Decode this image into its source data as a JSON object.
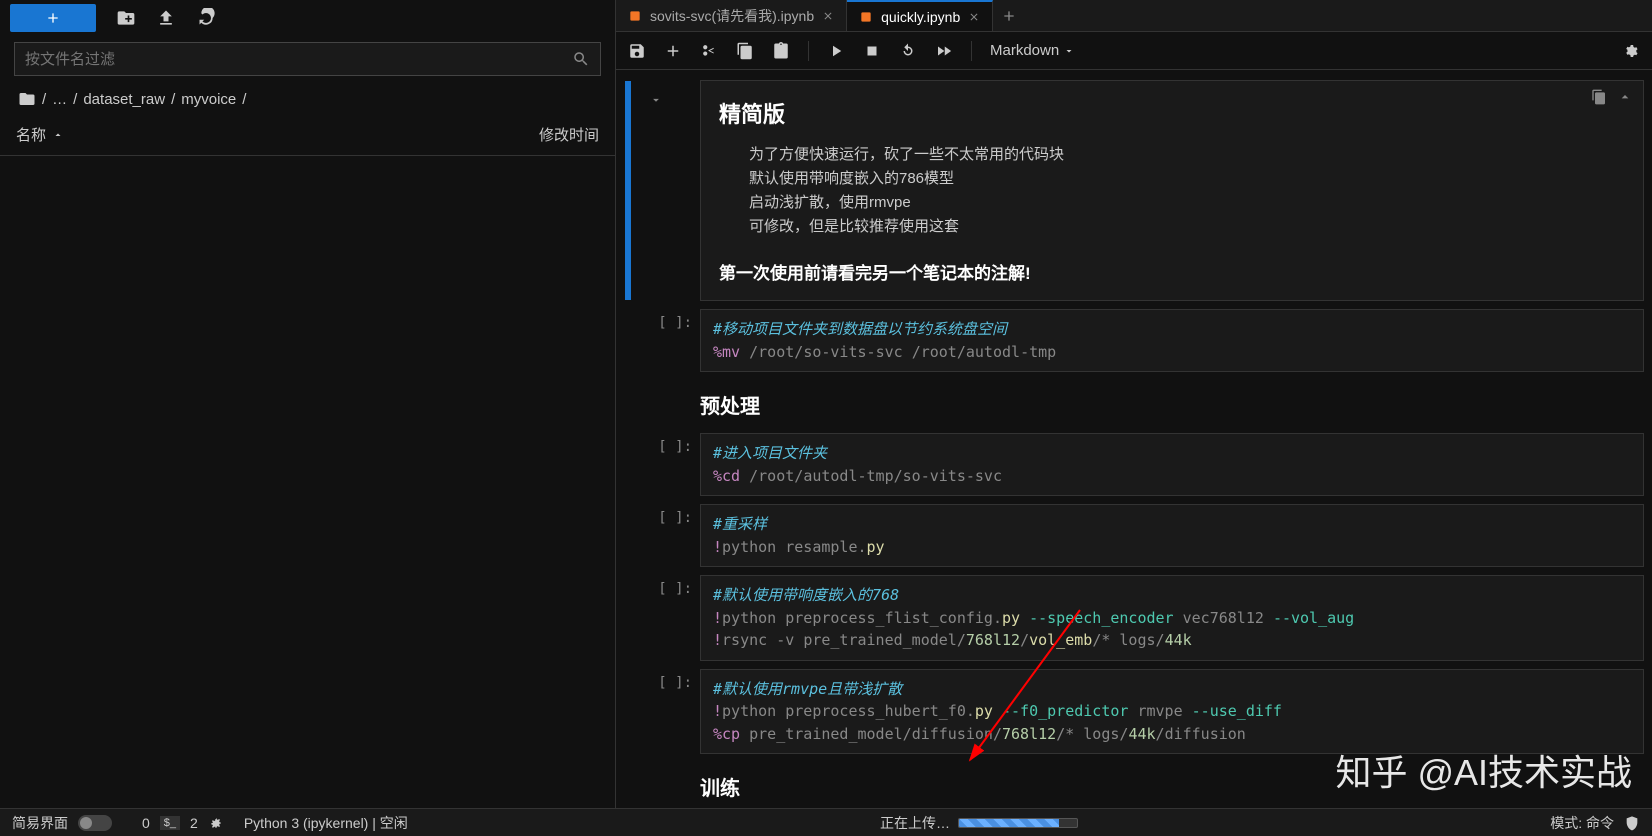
{
  "left_panel": {
    "filter_placeholder": "按文件名过滤",
    "breadcrumb": {
      "root_sep": "/",
      "dots": "…",
      "sep": "/",
      "p1": "dataset_raw",
      "p2": "myvoice"
    },
    "columns": {
      "name": "名称",
      "modified": "修改时间"
    }
  },
  "tabs": [
    {
      "label": "sovits-svc(请先看我).ipynb",
      "active": false
    },
    {
      "label": "quickly.ipynb",
      "active": true
    }
  ],
  "toolbar": {
    "celltype": "Markdown"
  },
  "notebook": {
    "md1": {
      "title": "精简版",
      "l1": "为了方便快速运行，砍了一些不太常用的代码块",
      "l2": "默认使用带响度嵌入的786模型",
      "l3": "启动浅扩散，使用rmvpe",
      "l4": "可修改，但是比较推荐使用这套",
      "bold": "第一次使用前请看完另一个笔记本的注解!"
    },
    "prompts": {
      "empty": "[ ]:"
    },
    "c1": {
      "comment": "#移动项目文件夹到数据盘以节约系统盘空间",
      "line": "%mv /root/so-vits-svc /root/autodl-tmp"
    },
    "h2_1": "预处理",
    "c2": {
      "comment": "#进入项目文件夹",
      "line": "%cd /root/autodl-tmp/so-vits-svc"
    },
    "c3": {
      "comment": "#重采样",
      "line": "!python resample.py"
    },
    "c4": {
      "comment": "#默认使用带响度嵌入的768",
      "l1": "!python preprocess_flist_config.py --speech_encoder vec768l12 --vol_aug",
      "l2": "!rsync -v pre_trained_model/768l12/vol_emb/* logs/44k"
    },
    "c5": {
      "comment": "#默认使用rmvpe且带浅扩散",
      "l1": "!python preprocess_hubert_f0.py --f0_predictor rmvpe --use_diff",
      "l2": "%cp pre_trained_model/diffusion/768l12/* logs/44k/diffusion"
    },
    "h2_2": "训练"
  },
  "status": {
    "simple": "简易界面",
    "terminals": "0",
    "term_badge": "$_",
    "kernels": "2",
    "kernel_text": "Python 3 (ipykernel) | 空闲",
    "uploading": "正在上传…",
    "mode": "模式: 命令"
  },
  "watermark": "知乎 @AI技术实战"
}
